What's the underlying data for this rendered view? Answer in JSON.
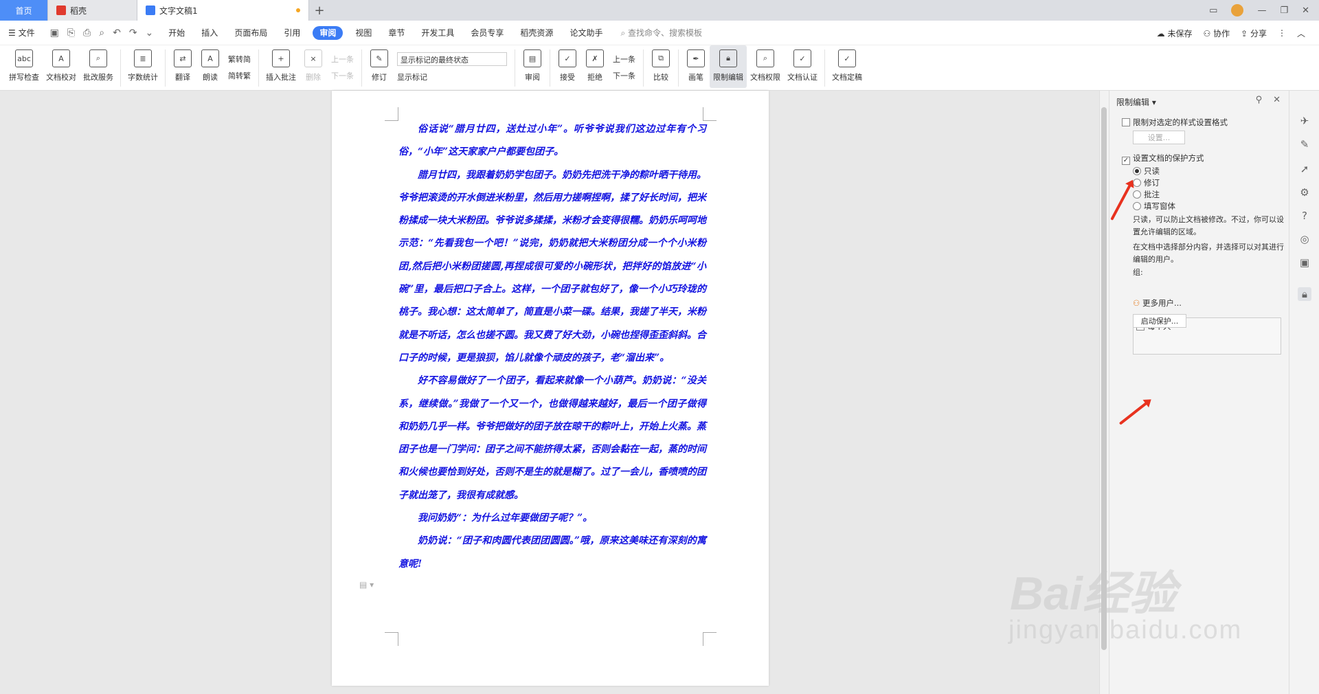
{
  "tabs": {
    "home": "首页",
    "daoke": "稻壳",
    "doc": "文字文稿1"
  },
  "menubar": {
    "file": "文件",
    "items": [
      "开始",
      "插入",
      "页面布局",
      "引用",
      "审阅",
      "视图",
      "章节",
      "开发工具",
      "会员专享",
      "稻壳资源",
      "论文助手"
    ],
    "active_index": 4,
    "search": "查找命令、搜索模板",
    "unsaved": "未保存",
    "collab": "协作",
    "share": "分享"
  },
  "ribbon": {
    "spellcheck": "拼写检查",
    "doccheck": "文档校对",
    "batch": "批改服务",
    "wordcount": "字数统计",
    "translate": "翻译",
    "read": "朗读",
    "trad2simp": "繁转简",
    "simp2trad": "简转繁",
    "insert_comment": "插入批注",
    "delete": "删除",
    "prev": "上一条",
    "next": "下一条",
    "revise": "修订",
    "markup_state": "显示标记的最终状态",
    "show_markup": "显示标记",
    "review": "审阅",
    "accept": "接受",
    "reject": "拒绝",
    "prev2": "上一条",
    "next2": "下一条",
    "compare": "比较",
    "pen": "画笔",
    "restrict": "限制编辑",
    "permission": "文档权限",
    "certify": "文档认证",
    "finalize": "文档定稿"
  },
  "document": {
    "paragraphs": [
      "俗话说“腊月廿四，送灶过小年”。听爷爷说我们这边过年有个习俗，“小年”这天家家户户都要包团子。",
      "腊月廿四，我跟着奶奶学包团子。奶奶先把洗干净的粽叶晒干待用。爷爷把滚烫的开水倒进米粉里，然后用力搓啊捏啊，揉了好长时间，把米粉揉成一块大米粉团。爷爷说多揉揉，米粉才会变得很糯。奶奶乐呵呵地示范：“先看我包一个吧！”说完，奶奶就把大米粉团分成一个个小米粉团,然后把小米粉团搓圆,再捏成很可爱的小碗形状，把拌好的馅放进“小碗”里，最后把口子合上。这样，一个团子就包好了，像一个小巧玲珑的桃子。我心想：这太简单了，简直是小菜一碟。结果，我搓了半天，米粉就是不听话，怎么也搓不圆。我又费了好大劲，小碗也捏得歪歪斜斜。合口子的时候，更是狼狈，馅儿就像个顽皮的孩子，老“溜出来”。",
      "好不容易做好了一个团子，看起来就像一个小葫芦。奶奶说：“没关系，继续做。”我做了一个又一个，也做得越来越好，最后一个团子做得和奶奶几乎一样。爷爷把做好的团子放在晾干的粽叶上，开始上火蒸。蒸团子也是一门学问：团子之间不能挤得太紧，否则会黏在一起，蒸的时间和火候也要恰到好处，否则不是生的就是糊了。过了一会儿，香喷喷的团子就出笼了，我很有成就感。",
      "我问奶奶“：为什么过年要做团子呢？”。",
      "奶奶说：“团子和肉圆代表团团圆圆。”哦，原来这美味还有深刻的寓意呢!"
    ],
    "color": "#1414e0"
  },
  "panel": {
    "title": "限制编辑",
    "restrict_style": "限制对选定的样式设置格式",
    "settings_btn": "设置...",
    "protect_method": "设置文档的保护方式",
    "opt_readonly": "只读",
    "opt_revise": "修订",
    "opt_comment": "批注",
    "opt_form": "填写窗体",
    "desc1": "只读，可以防止文档被修改。不过，你可以设置允许编辑的区域。",
    "desc2": "在文档中选择部分内容，并选择可以对其进行编辑的用户。",
    "group_label": "组:",
    "everyone": "每个人",
    "more_users": "更多用户...",
    "start_btn": "启动保护..."
  },
  "watermark": {
    "line1": "Bai经验",
    "line2": "jingyan.baidu.com"
  },
  "colors": {
    "accent": "#3b7cf5",
    "arrow": "#e8321f"
  }
}
